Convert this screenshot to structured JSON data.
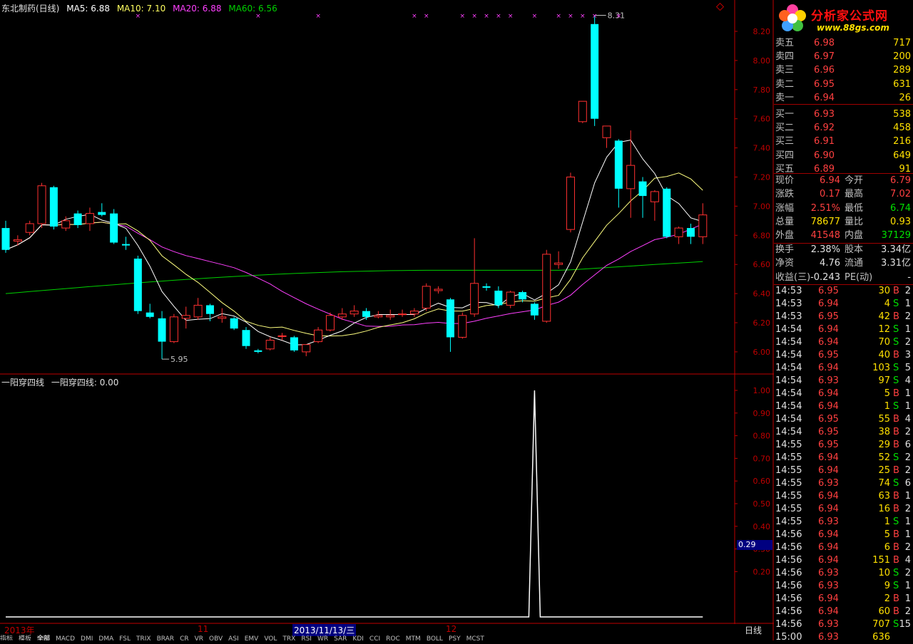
{
  "header": {
    "stock": "东北制药(日线)",
    "ma5": "MA5: 6.88",
    "ma10": "MA10: 7.10",
    "ma20": "MA20: 6.88",
    "ma60": "MA60: 6.56"
  },
  "indicator": {
    "name": "一阳穿四线",
    "value_label": "一阳穿四线: 0.00"
  },
  "colors": {
    "up": "#ff3030",
    "down": "#00ffff",
    "ma5": "#ffffff",
    "ma10": "#ffff80",
    "ma20": "#ff40ff",
    "ma60": "#00d000",
    "axis": "#c00000"
  },
  "date_bar": {
    "year": "2013年",
    "nov": "11",
    "selected": "2013/11/13/三",
    "dec": "12"
  },
  "tabs": [
    "指标",
    "模板",
    "全部",
    "MACD",
    "DMI",
    "DMA",
    "FSL",
    "TRIX",
    "BRAR",
    "CR",
    "VR",
    "OBV",
    "ASI",
    "EMV",
    "VOL",
    "TRX",
    "RSI",
    "WR",
    "SAR",
    "KDJ",
    "CCI",
    "ROC",
    "MTM",
    "BOLL",
    "PSY",
    "MCST"
  ],
  "period_label": "日线",
  "cursor_value": "0.29",
  "logo": {
    "title": "分析家公式网",
    "url": "www.88gs.com"
  },
  "order_book": [
    {
      "label": "卖五",
      "price": "6.98",
      "volume": "717"
    },
    {
      "label": "卖四",
      "price": "6.97",
      "volume": "200"
    },
    {
      "label": "卖三",
      "price": "6.96",
      "volume": "289"
    },
    {
      "label": "卖二",
      "price": "6.95",
      "volume": "631"
    },
    {
      "label": "卖一",
      "price": "6.94",
      "volume": "26"
    },
    {
      "label": "买一",
      "price": "6.93",
      "volume": "538"
    },
    {
      "label": "买二",
      "price": "6.92",
      "volume": "458"
    },
    {
      "label": "买三",
      "price": "6.91",
      "volume": "216"
    },
    {
      "label": "买四",
      "price": "6.90",
      "volume": "649"
    },
    {
      "label": "买五",
      "price": "6.89",
      "volume": "91"
    }
  ],
  "quote": [
    {
      "l1": "现价",
      "v1": "6.94",
      "c1": "red",
      "l2": "今开",
      "v2": "6.79",
      "c2": "red"
    },
    {
      "l1": "涨跌",
      "v1": "0.17",
      "c1": "red",
      "l2": "最高",
      "v2": "7.02",
      "c2": "red"
    },
    {
      "l1": "涨幅",
      "v1": "2.51%",
      "c1": "red",
      "l2": "最低",
      "v2": "6.74",
      "c2": "green"
    },
    {
      "l1": "总量",
      "v1": "78677",
      "c1": "yellow",
      "l2": "量比",
      "v2": "0.93",
      "c2": "yellow"
    },
    {
      "l1": "外盘",
      "v1": "41548",
      "c1": "red",
      "l2": "内盘",
      "v2": "37129",
      "c2": "green"
    }
  ],
  "fundamentals": [
    {
      "l1": "换手",
      "v1": "2.38%",
      "l2": "股本",
      "v2": "3.34亿"
    },
    {
      "l1": "净资",
      "v1": "4.76",
      "l2": "流通",
      "v2": "3.31亿"
    },
    {
      "l1": "收益(三)",
      "v1": "-0.243",
      "l2": "PE(动)",
      "v2": "-"
    }
  ],
  "ticks": [
    [
      "14:53",
      "6.95",
      "30",
      "B",
      "2"
    ],
    [
      "14:53",
      "6.94",
      "4",
      "S",
      "1"
    ],
    [
      "14:53",
      "6.95",
      "42",
      "B",
      "2"
    ],
    [
      "14:54",
      "6.94",
      "12",
      "S",
      "1"
    ],
    [
      "14:54",
      "6.94",
      "70",
      "S",
      "2"
    ],
    [
      "14:54",
      "6.95",
      "40",
      "B",
      "3"
    ],
    [
      "14:54",
      "6.94",
      "103",
      "S",
      "5"
    ],
    [
      "14:54",
      "6.93",
      "97",
      "S",
      "4"
    ],
    [
      "14:54",
      "6.94",
      "5",
      "B",
      "1"
    ],
    [
      "14:54",
      "6.94",
      "1",
      "S",
      "1"
    ],
    [
      "14:54",
      "6.95",
      "55",
      "B",
      "4"
    ],
    [
      "14:54",
      "6.95",
      "38",
      "B",
      "2"
    ],
    [
      "14:55",
      "6.95",
      "29",
      "B",
      "6"
    ],
    [
      "14:55",
      "6.94",
      "52",
      "S",
      "2"
    ],
    [
      "14:55",
      "6.94",
      "25",
      "B",
      "2"
    ],
    [
      "14:55",
      "6.93",
      "74",
      "S",
      "6"
    ],
    [
      "14:55",
      "6.94",
      "63",
      "B",
      "1"
    ],
    [
      "14:55",
      "6.94",
      "16",
      "B",
      "2"
    ],
    [
      "14:55",
      "6.93",
      "1",
      "S",
      "1"
    ],
    [
      "14:56",
      "6.94",
      "5",
      "B",
      "1"
    ],
    [
      "14:56",
      "6.94",
      "6",
      "B",
      "2"
    ],
    [
      "14:56",
      "6.94",
      "151",
      "B",
      "4"
    ],
    [
      "14:56",
      "6.93",
      "10",
      "S",
      "2"
    ],
    [
      "14:56",
      "6.93",
      "9",
      "S",
      "1"
    ],
    [
      "14:56",
      "6.94",
      "2",
      "B",
      "1"
    ],
    [
      "14:56",
      "6.94",
      "60",
      "B",
      "2"
    ],
    [
      "14:56",
      "6.93",
      "707",
      "S",
      "15"
    ],
    [
      "15:00",
      "6.93",
      "636",
      "",
      ""
    ]
  ],
  "chart_data": {
    "type": "candlestick",
    "price_axis": {
      "ticks": [
        "8.20",
        "8.00",
        "7.80",
        "7.60",
        "7.40",
        "7.20",
        "7.00",
        "6.80",
        "6.60",
        "6.40",
        "6.20",
        "6.00"
      ],
      "ylim": [
        5.85,
        8.32
      ]
    },
    "indicator_axis": {
      "ticks": [
        "1.00",
        "0.90",
        "0.80",
        "0.70",
        "0.60",
        "0.50",
        "0.40",
        "0.30",
        "0.20"
      ],
      "ylim": [
        0,
        1.05
      ]
    },
    "annotations": {
      "high": "8.31",
      "low": "5.95"
    },
    "candles": [
      {
        "o": 6.85,
        "h": 6.9,
        "l": 6.68,
        "c": 6.7
      },
      {
        "o": 6.76,
        "h": 6.8,
        "l": 6.73,
        "c": 6.77
      },
      {
        "o": 6.82,
        "h": 6.9,
        "l": 6.8,
        "c": 6.88
      },
      {
        "o": 6.88,
        "h": 7.16,
        "l": 6.85,
        "c": 7.14
      },
      {
        "o": 7.13,
        "h": 7.14,
        "l": 6.84,
        "c": 6.86
      },
      {
        "o": 6.85,
        "h": 6.93,
        "l": 6.83,
        "c": 6.9
      },
      {
        "o": 6.95,
        "h": 6.97,
        "l": 6.85,
        "c": 6.87
      },
      {
        "o": 6.88,
        "h": 6.99,
        "l": 6.83,
        "c": 6.95
      },
      {
        "o": 6.96,
        "h": 7.02,
        "l": 6.93,
        "c": 6.94
      },
      {
        "o": 6.95,
        "h": 6.98,
        "l": 6.74,
        "c": 6.75
      },
      {
        "o": 6.74,
        "h": 6.79,
        "l": 6.7,
        "c": 6.73
      },
      {
        "o": 6.64,
        "h": 6.66,
        "l": 6.26,
        "c": 6.28
      },
      {
        "o": 6.27,
        "h": 6.33,
        "l": 6.23,
        "c": 6.24
      },
      {
        "o": 6.23,
        "h": 6.28,
        "l": 5.95,
        "c": 6.07
      },
      {
        "o": 6.07,
        "h": 6.26,
        "l": 6.06,
        "c": 6.24
      },
      {
        "o": 6.23,
        "h": 6.31,
        "l": 6.16,
        "c": 6.25
      },
      {
        "o": 6.24,
        "h": 6.37,
        "l": 6.22,
        "c": 6.32
      },
      {
        "o": 6.32,
        "h": 6.33,
        "l": 6.21,
        "c": 6.26
      },
      {
        "o": 6.23,
        "h": 6.3,
        "l": 6.2,
        "c": 6.24
      },
      {
        "o": 6.23,
        "h": 6.24,
        "l": 6.15,
        "c": 6.16
      },
      {
        "o": 6.15,
        "h": 6.17,
        "l": 6.02,
        "c": 6.04
      },
      {
        "o": 6.01,
        "h": 6.02,
        "l": 5.99,
        "c": 6.0
      },
      {
        "o": 6.02,
        "h": 6.1,
        "l": 6.01,
        "c": 6.08
      },
      {
        "o": 6.11,
        "h": 6.13,
        "l": 6.08,
        "c": 6.11
      },
      {
        "o": 6.1,
        "h": 6.11,
        "l": 6.0,
        "c": 6.01
      },
      {
        "o": 6.0,
        "h": 6.05,
        "l": 5.97,
        "c": 6.05
      },
      {
        "o": 6.07,
        "h": 6.17,
        "l": 6.06,
        "c": 6.15
      },
      {
        "o": 6.15,
        "h": 6.27,
        "l": 6.14,
        "c": 6.25
      },
      {
        "o": 6.24,
        "h": 6.3,
        "l": 6.22,
        "c": 6.26
      },
      {
        "o": 6.26,
        "h": 6.32,
        "l": 6.24,
        "c": 6.28
      },
      {
        "o": 6.28,
        "h": 6.3,
        "l": 6.22,
        "c": 6.24
      },
      {
        "o": 6.24,
        "h": 6.28,
        "l": 6.23,
        "c": 6.25
      },
      {
        "o": 6.24,
        "h": 6.29,
        "l": 6.22,
        "c": 6.25
      },
      {
        "o": 6.26,
        "h": 6.29,
        "l": 6.24,
        "c": 6.26
      },
      {
        "o": 6.26,
        "h": 6.3,
        "l": 6.24,
        "c": 6.28
      },
      {
        "o": 6.3,
        "h": 6.47,
        "l": 6.28,
        "c": 6.45
      },
      {
        "o": 6.42,
        "h": 6.45,
        "l": 6.4,
        "c": 6.43
      },
      {
        "o": 6.36,
        "h": 6.37,
        "l": 6.0,
        "c": 6.1
      },
      {
        "o": 6.1,
        "h": 6.27,
        "l": 6.09,
        "c": 6.25
      },
      {
        "o": 6.26,
        "h": 6.78,
        "l": 6.24,
        "c": 6.47
      },
      {
        "o": 6.45,
        "h": 6.47,
        "l": 6.42,
        "c": 6.44
      },
      {
        "o": 6.42,
        "h": 6.45,
        "l": 6.3,
        "c": 6.32
      },
      {
        "o": 6.32,
        "h": 6.42,
        "l": 6.3,
        "c": 6.41
      },
      {
        "o": 6.41,
        "h": 6.42,
        "l": 6.34,
        "c": 6.36
      },
      {
        "o": 6.33,
        "h": 6.34,
        "l": 6.22,
        "c": 6.25
      },
      {
        "o": 6.21,
        "h": 6.7,
        "l": 6.2,
        "c": 6.67
      },
      {
        "o": 6.6,
        "h": 6.69,
        "l": 6.57,
        "c": 6.61
      },
      {
        "o": 6.84,
        "h": 7.23,
        "l": 6.82,
        "c": 7.2
      },
      {
        "o": 7.58,
        "h": 7.72,
        "l": 7.57,
        "c": 7.72
      },
      {
        "o": 8.25,
        "h": 8.31,
        "l": 7.55,
        "c": 7.6
      },
      {
        "o": 7.47,
        "h": 7.55,
        "l": 7.4,
        "c": 7.55
      },
      {
        "o": 7.45,
        "h": 7.46,
        "l": 6.99,
        "c": 7.12
      },
      {
        "o": 7.12,
        "h": 7.52,
        "l": 6.92,
        "c": 7.28
      },
      {
        "o": 7.17,
        "h": 7.2,
        "l": 6.92,
        "c": 7.07
      },
      {
        "o": 7.03,
        "h": 7.11,
        "l": 6.9,
        "c": 7.1
      },
      {
        "o": 7.12,
        "h": 7.13,
        "l": 6.78,
        "c": 6.79
      },
      {
        "o": 6.79,
        "h": 6.86,
        "l": 6.74,
        "c": 6.85
      },
      {
        "o": 6.85,
        "h": 6.88,
        "l": 6.74,
        "c": 6.79
      },
      {
        "o": 6.79,
        "h": 7.02,
        "l": 6.74,
        "c": 6.94
      }
    ],
    "signal_index": 44,
    "cross_marks": [
      11,
      21,
      26,
      34,
      35,
      38,
      39,
      40,
      41,
      42,
      44,
      46,
      47,
      48,
      49,
      51
    ]
  }
}
